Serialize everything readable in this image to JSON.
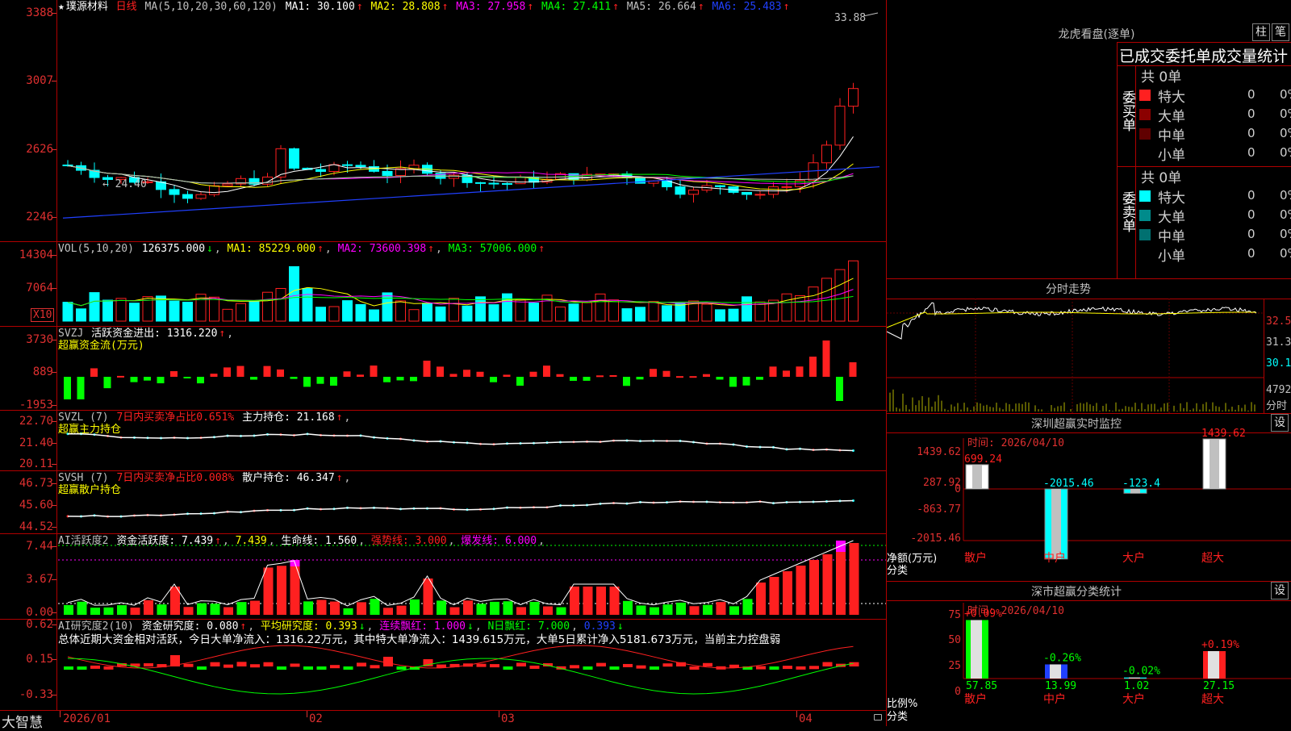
{
  "stock": {
    "star": "★",
    "name": "璞源材料",
    "period": "日线"
  },
  "kline": {
    "header_ma": "MA(5,10,20,30,60,120)",
    "ma1": "MA1: 30.100",
    "ma2": "MA2: 28.808",
    "ma3": "MA3: 27.958",
    "ma4": "MA4: 27.411",
    "ma5": "MA5: 26.664",
    "ma6": "MA6: 25.483",
    "arrow_up": "↑",
    "arrow_down": "↓",
    "y_labels": [
      "3388",
      "3007",
      "2626",
      "2246"
    ],
    "high_mark": "33.88",
    "low_mark": "← 24.40",
    "colors": {
      "up": "#ff2020",
      "down": "#00ffff",
      "ma1": "#ffffff",
      "ma2": "#ffff00",
      "ma3": "#ff00ff",
      "ma4": "#00ff00",
      "ma5": "#c0c0c0",
      "ma6": "#2040ff"
    }
  },
  "vol": {
    "header": "VOL(5,10,20)",
    "value": "126375.000",
    "ma1": "MA1: 85229.000",
    "ma2": "MA2: 73600.398",
    "ma3": "MA3: 57006.000",
    "y_labels": [
      "14304",
      "7064"
    ],
    "unit": "X10"
  },
  "svzj": {
    "title": "SVZJ",
    "label": "活跃资金进出: 1316.220",
    "sub": "超赢资金流(万元)",
    "y_labels": [
      "3730",
      "889",
      "-1953"
    ]
  },
  "svzl": {
    "title": "SVZL  (7)",
    "label1": "7日内买卖净占比0.651%",
    "label2": "主力持仓: 21.168",
    "sub": "超赢主力持仓",
    "y_labels": [
      "22.70",
      "21.40",
      "20.11"
    ]
  },
  "svsh": {
    "title": "SVSH  (7)",
    "label1": "7日内买卖净占比0.008%",
    "label2": "散户持仓: 46.347",
    "sub": "超赢散户持仓",
    "y_labels": [
      "46.73",
      "45.60",
      "44.52"
    ]
  },
  "ai_active": {
    "title": "AI活跃度2",
    "l1": "资金活跃度: 7.439",
    "l2": "7.439",
    "l3": "生命线: 1.560",
    "l4": "强势线: 3.000",
    "l5": "爆发线: 6.000",
    "y_labels": [
      "7.44",
      "3.67",
      "0.00"
    ]
  },
  "ai_research": {
    "title": "AI研究度2(10)",
    "l1": "资金研究度: 0.080",
    "l2": "平均研究度: 0.393",
    "l3": "连续飘红: 1.000",
    "l4": "N日飘红: 7.000",
    "l5": "0.393",
    "summary": "总体近期大资金相对活跃，今日大单净流入：1316.22万元，其中特大单净流入：1439.615万元，大单5日累计净入5181.673万元，当前主力控盘弱",
    "y_labels": [
      "0.62",
      "0.15",
      "-0.33"
    ]
  },
  "date_axis": {
    "labels": [
      "2026/01",
      "02",
      "03",
      "04"
    ],
    "brand": "大智慧"
  },
  "longhu": {
    "title": "龙虎看盘(逐单)",
    "btn1": "柱",
    "btn2": "笔",
    "tabs": "已成交委托单成交量统计",
    "buy": {
      "side": "委买单",
      "total": "共 0单",
      "rows": [
        {
          "label": "特大",
          "num": "0",
          "pct": "0%"
        },
        {
          "label": "大单",
          "num": "0",
          "pct": "0%"
        },
        {
          "label": "中单",
          "num": "0",
          "pct": "0%"
        },
        {
          "label": "小单",
          "num": "0",
          "pct": "0%"
        }
      ]
    },
    "sell": {
      "side": "委卖单",
      "total": "共 0单",
      "rows": [
        {
          "label": "特大",
          "num": "0",
          "pct": "0%"
        },
        {
          "label": "大单",
          "num": "0",
          "pct": "0%"
        },
        {
          "label": "中单",
          "num": "0",
          "pct": "0%"
        },
        {
          "label": "小单",
          "num": "0",
          "pct": "0%"
        }
      ]
    }
  },
  "fenshi": {
    "title": "分时走势",
    "y_labels": [
      "32.5",
      "31.3",
      "30.1"
    ],
    "vol_label": "4792",
    "unit": "分时"
  },
  "sz_monitor": {
    "title": "深圳超赢实时监控",
    "btn": "设",
    "time": "时间: 2026/04/10",
    "y_labels": [
      "1439.62",
      "287.92",
      "0",
      "-863.77",
      "-2015.46"
    ],
    "ylabel": "净额(万元)",
    "xlabel": "分类",
    "bars": [
      {
        "cat": "散户",
        "value": 699.24,
        "label": "699.24"
      },
      {
        "cat": "中户",
        "value": -2015.46,
        "label": "-2015.46"
      },
      {
        "cat": "大户",
        "value": -123.4,
        "label": "-123.4"
      },
      {
        "cat": "超大",
        "value": 1439.62,
        "label": "1439.62"
      }
    ]
  },
  "sz_class": {
    "title": "深市超赢分类统计",
    "btn": "设",
    "time": "时间: 2026/04/10",
    "y_labels": [
      "75",
      "50",
      "25",
      "0"
    ],
    "ylabel": "比例%",
    "xlabel": "分类",
    "bars": [
      {
        "cat": "散户",
        "value": 57.85,
        "val_label": "57.85",
        "chg": "+0.09%"
      },
      {
        "cat": "中户",
        "value": 13.99,
        "val_label": "13.99",
        "chg": "-0.26%"
      },
      {
        "cat": "大户",
        "value": 1.02,
        "val_label": "1.02",
        "chg": "-0.02%"
      },
      {
        "cat": "超大",
        "value": 27.15,
        "val_label": "27.15",
        "chg": "+0.19%"
      }
    ]
  }
}
